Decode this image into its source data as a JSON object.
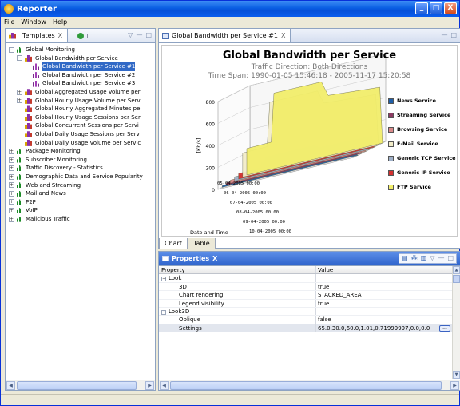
{
  "window": {
    "title": "Reporter",
    "buttons": {
      "minimize": "_",
      "maximize": "□",
      "close": "X"
    }
  },
  "menu": [
    "File",
    "Window",
    "Help"
  ],
  "templates_view": {
    "tab_label": "Templates",
    "tab_close": "X",
    "view_menu": "▽",
    "minimize": "—",
    "maximize": "□",
    "tree": [
      {
        "level": 0,
        "expander": "−",
        "icon": "green",
        "label": "Global Monitoring"
      },
      {
        "level": 1,
        "expander": "−",
        "icon": "chartgroup",
        "label": "Global Bandwidth per Service"
      },
      {
        "level": 2,
        "expander": "",
        "icon": "purple",
        "label": "Global Bandwidth per Service #1",
        "selected": true
      },
      {
        "level": 2,
        "expander": "",
        "icon": "purple",
        "label": "Global Bandwidth per Service #2"
      },
      {
        "level": 2,
        "expander": "",
        "icon": "purple",
        "label": "Global Bandwidth per Service #3"
      },
      {
        "level": 1,
        "expander": "+",
        "icon": "chartgroup",
        "label": "Global Aggregated Usage Volume per"
      },
      {
        "level": 1,
        "expander": "+",
        "icon": "chartgroup",
        "label": "Global Hourly Usage Volume per Serv"
      },
      {
        "level": 1,
        "expander": "",
        "icon": "chartgroup",
        "label": "Global Hourly Aggregated Minutes pe"
      },
      {
        "level": 1,
        "expander": "",
        "icon": "chartgroup",
        "label": "Global Hourly Usage Sessions per Ser"
      },
      {
        "level": 1,
        "expander": "",
        "icon": "chartgroup",
        "label": "Global Concurrent Sessions per Servi"
      },
      {
        "level": 1,
        "expander": "",
        "icon": "chartgroup",
        "label": "Global Daily Usage Sessions per Serv"
      },
      {
        "level": 1,
        "expander": "",
        "icon": "chartgroup",
        "label": "Global Daily Usage Volume per Servic"
      },
      {
        "level": 0,
        "expander": "+",
        "icon": "green",
        "label": "Package Monitoring"
      },
      {
        "level": 0,
        "expander": "+",
        "icon": "green",
        "label": "Subscriber Monitoring"
      },
      {
        "level": 0,
        "expander": "+",
        "icon": "green",
        "label": "Traffic Discovery - Statistics"
      },
      {
        "level": 0,
        "expander": "+",
        "icon": "green",
        "label": "Demographic Data and Service Popularity"
      },
      {
        "level": 0,
        "expander": "+",
        "icon": "green",
        "label": "Web and Streaming"
      },
      {
        "level": 0,
        "expander": "+",
        "icon": "green",
        "label": "Mail and News"
      },
      {
        "level": 0,
        "expander": "+",
        "icon": "green",
        "label": "P2P"
      },
      {
        "level": 0,
        "expander": "+",
        "icon": "green",
        "label": "VoIP"
      },
      {
        "level": 0,
        "expander": "+",
        "icon": "green",
        "label": "Malicious Traffic"
      }
    ]
  },
  "chart_view": {
    "tab_label": "Global Bandwidth per Service #1",
    "tab_close": "X",
    "bottom_tabs": [
      "Chart",
      "Table"
    ]
  },
  "chart_data": {
    "type": "area",
    "title": "Global Bandwidth per Service",
    "subtitle1": "Traffic Direction: Both Directions",
    "subtitle2": "Time Span: 1990-01-05 15:46:18 - 2005-11-17 15:20:58",
    "ylabel": "[Kb/s]",
    "xlabel": "Date and Time",
    "ylim": [
      0,
      800
    ],
    "yticks": [
      0,
      200,
      400,
      600,
      800
    ],
    "categories": [
      "05-04-2005 00:00",
      "06-04-2005 00:00",
      "07-04-2005 00:00",
      "08-04-2005 00:00",
      "09-04-2005 00:00",
      "10-04-2005 00:00"
    ],
    "stacked": true,
    "rendering": "3D",
    "legend_position": "right",
    "series": [
      {
        "name": "News Service",
        "color": "#1f5fa8"
      },
      {
        "name": "Streaming Service",
        "color": "#8b3a62"
      },
      {
        "name": "Browsing Service",
        "color": "#d98a8a"
      },
      {
        "name": "E-Mail Service",
        "color": "#f3edc9"
      },
      {
        "name": "Generic TCP Service",
        "color": "#9fb0c8"
      },
      {
        "name": "Generic IP Service",
        "color": "#d4302f"
      },
      {
        "name": "FTP Service",
        "color": "#f2ee6b"
      }
    ]
  },
  "properties_view": {
    "tab_label": "Properties",
    "tab_close": "X",
    "columns": [
      "Property",
      "Value"
    ],
    "rows": [
      {
        "level": 0,
        "expander": "−",
        "name": "Look",
        "value": ""
      },
      {
        "level": 1,
        "expander": "",
        "name": "3D",
        "value": "true"
      },
      {
        "level": 1,
        "expander": "",
        "name": "Chart rendering",
        "value": "STACKED_AREA"
      },
      {
        "level": 1,
        "expander": "",
        "name": "Legend visibility",
        "value": "true"
      },
      {
        "level": 0,
        "expander": "−",
        "name": "Look3D",
        "value": ""
      },
      {
        "level": 1,
        "expander": "",
        "name": "Oblique",
        "value": "false"
      },
      {
        "level": 1,
        "expander": "",
        "name": "Settings",
        "value": "65.0,30.0,60.0,1.01,0.71999997,0.0,0.0",
        "selected": true
      }
    ],
    "dots_button": "..."
  },
  "colors": {
    "selection": "#3169c6",
    "titlebar": "#0a5fe3"
  }
}
